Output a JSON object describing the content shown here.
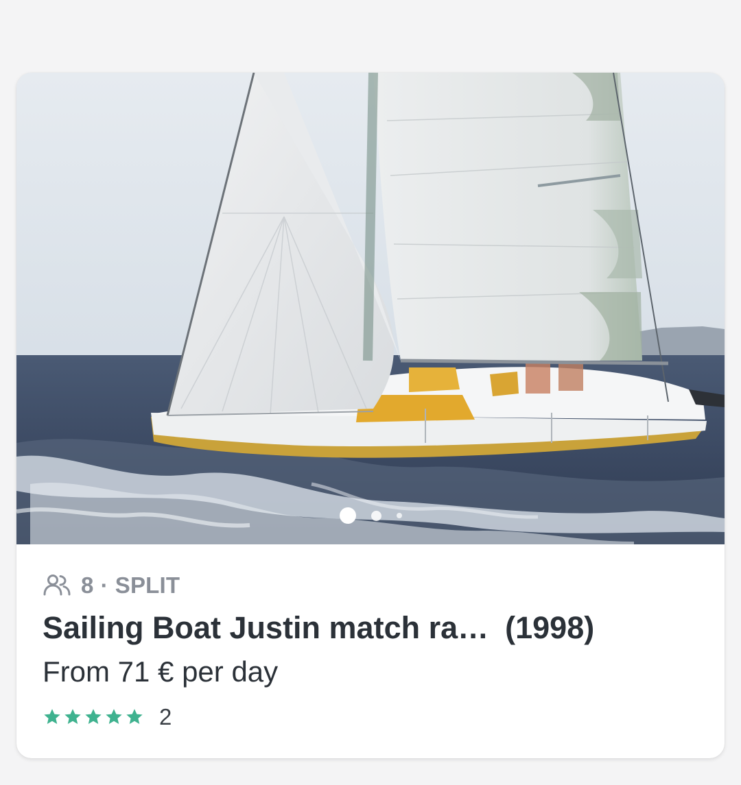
{
  "listing": {
    "capacity": "8",
    "separator": "·",
    "location": "SPLIT",
    "title": "Sailing Boat Justin match ra…",
    "year": "(1998)",
    "price_text": "From 71 € per day",
    "rating_stars": 5,
    "review_count": "2",
    "photo": {
      "subject": "white-sailboat-with-yellow-deck-on-sea",
      "current_index": 1,
      "visible_indicators": 3
    }
  },
  "colors": {
    "star": "#3fb28f",
    "text_primary": "#2b3138",
    "text_muted": "#8a8f98",
    "page_background": "#f4f4f5",
    "card_background": "#ffffff"
  },
  "icons": {
    "people": "people-icon",
    "star": "star-icon"
  }
}
